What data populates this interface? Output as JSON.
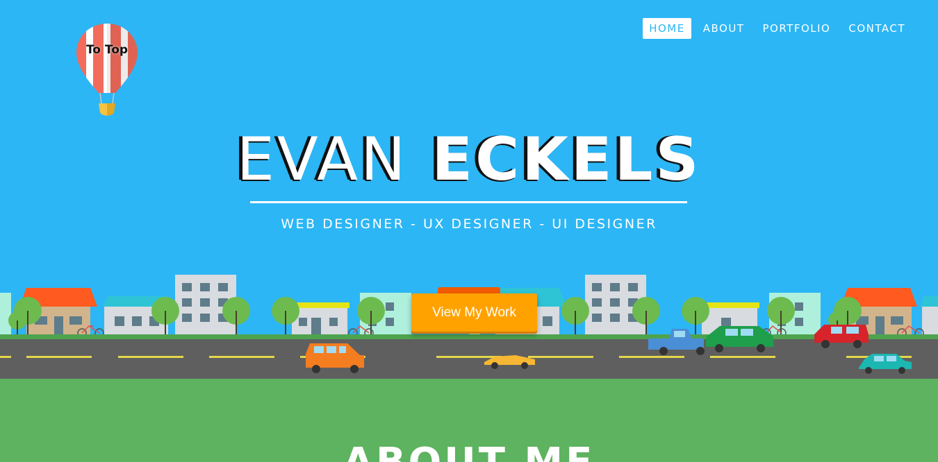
{
  "nav": {
    "items": [
      {
        "label": "HOME",
        "active": true
      },
      {
        "label": "ABOUT",
        "active": false
      },
      {
        "label": "PORTFOLIO",
        "active": false
      },
      {
        "label": "CONTACT",
        "active": false
      }
    ]
  },
  "balloon": {
    "label": "To Top"
  },
  "hero": {
    "first_name": "EVAN",
    "last_name": "ECKELS",
    "subtitle": "WEB DESIGNER - UX DESIGNER - UI DESIGNER",
    "cta_label": "View My Work"
  },
  "about": {
    "title": "ABOUT ME"
  },
  "colors": {
    "sky": "#2cb6f5",
    "cta": "#ffa200",
    "grass": "#5db35f",
    "road": "#5f5f5f"
  }
}
